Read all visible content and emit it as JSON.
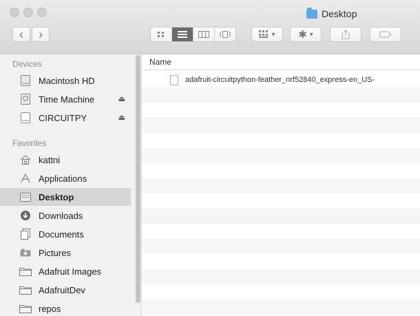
{
  "window": {
    "title": "Desktop"
  },
  "toolbar": {
    "back_label": "‹",
    "forward_label": "›",
    "arrange_label": "▾",
    "action_label": "▾",
    "view_icons": [
      "icon-view",
      "list-view",
      "column-view",
      "coverflow-view"
    ],
    "active_view": "list-view"
  },
  "sidebar": {
    "devices_title": "Devices",
    "devices": [
      {
        "label": "Macintosh HD",
        "icon": "hard-drive-icon"
      },
      {
        "label": "Time Machine",
        "icon": "time-machine-icon",
        "eject": "⏏"
      },
      {
        "label": "CIRCUITPY",
        "icon": "drive-icon",
        "eject": "⏏"
      }
    ],
    "favorites_title": "Favorites",
    "favorites": [
      {
        "label": "kattni",
        "icon": "home-icon"
      },
      {
        "label": "Applications",
        "icon": "applications-icon"
      },
      {
        "label": "Desktop",
        "icon": "desktop-icon",
        "selected": true
      },
      {
        "label": "Downloads",
        "icon": "downloads-icon"
      },
      {
        "label": "Documents",
        "icon": "documents-icon"
      },
      {
        "label": "Pictures",
        "icon": "pictures-icon"
      },
      {
        "label": "Adafruit Images",
        "icon": "folder-icon"
      },
      {
        "label": "AdafruitDev",
        "icon": "folder-icon"
      },
      {
        "label": "repos",
        "icon": "folder-icon"
      }
    ]
  },
  "list": {
    "column_header": "Name",
    "files": [
      {
        "name": "adafruit-circuitpython-feather_nrf52840_express-en_US-"
      }
    ]
  }
}
